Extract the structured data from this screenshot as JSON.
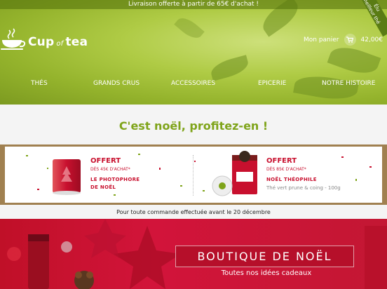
{
  "topbar": {
    "text": "Livraison offerte à partir de 65€ d'achat !"
  },
  "ribbon": {
    "line1": "Élu",
    "line2": "meilleur thé"
  },
  "logo": {
    "brand_first": "Cup",
    "brand_mid": "of",
    "brand_last": "tea"
  },
  "cart": {
    "label": "Mon panier",
    "amount": "42,00€"
  },
  "nav": {
    "items": [
      {
        "label": "THÉS"
      },
      {
        "label": "GRANDS CRUS"
      },
      {
        "label": "ACCESSOIRES"
      },
      {
        "label": "EPICERIE"
      },
      {
        "label": "NOTRE HISTOIRE"
      }
    ]
  },
  "promo": {
    "title": "C'est noël, profitez-en !"
  },
  "offers": [
    {
      "headline": "OFFERT",
      "minimum": "DÈS 45€ D'ACHAT*",
      "name_line1": "LE PHOTOPHORE",
      "name_line2": "DE NOËL",
      "subtitle": ""
    },
    {
      "headline": "OFFERT",
      "minimum": "DÈS 85€ D'ACHAT*",
      "name_line1": "NOËL THÉOPHILE",
      "name_line2": "",
      "subtitle": "Thé vert prune & coing - 100g"
    }
  ],
  "notice": {
    "text": "Pour toute commande effectuée avant le 20 décembre"
  },
  "banner": {
    "title": "BOUTIQUE DE NOËL",
    "subtitle": "Toutes nos idées cadeaux"
  },
  "colors": {
    "accent_green": "#7fa41a",
    "xmas_red": "#c8102e"
  },
  "icons": {
    "cart": "cart-icon",
    "logo": "teacup-icon"
  }
}
